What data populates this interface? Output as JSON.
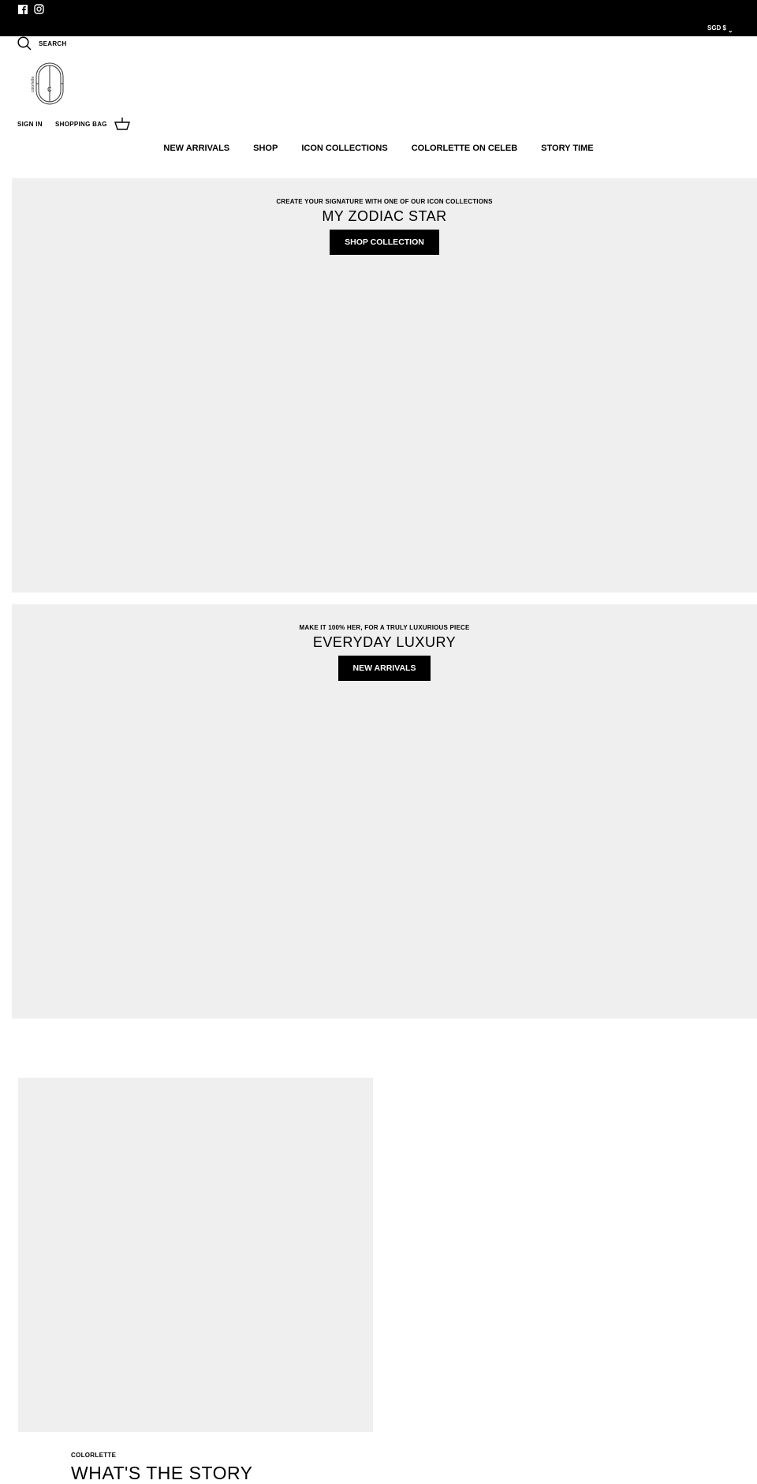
{
  "topbar": {
    "currency": "SGD $",
    "social": [
      "facebook-icon",
      "instagram-icon"
    ]
  },
  "header": {
    "search_label": "SEARCH",
    "logo_text": "colorlette",
    "sign_in": "SIGN IN",
    "shopping_bag": "SHOPPING BAG"
  },
  "nav": {
    "items": [
      "NEW ARRIVALS",
      "SHOP",
      "ICON COLLECTIONS",
      "COLORLETTE ON CELEB",
      "STORY TIME"
    ]
  },
  "banners": [
    {
      "subtitle": "CREATE YOUR SIGNATURE WITH ONE OF OUR ICON COLLECTIONS",
      "title": "MY ZODIAC STAR",
      "button": "SHOP COLLECTION"
    },
    {
      "subtitle": "MAKE IT 100% HER, FOR A TRULY LUXURIOUS PIECE",
      "title": "EVERYDAY LUXURY",
      "button": "NEW ARRIVALS"
    }
  ],
  "story": {
    "label": "COLORLETTE",
    "title": "WHAT'S THE STORY"
  },
  "colors": {
    "bar": "#000000",
    "placeholder": "#efefef"
  }
}
